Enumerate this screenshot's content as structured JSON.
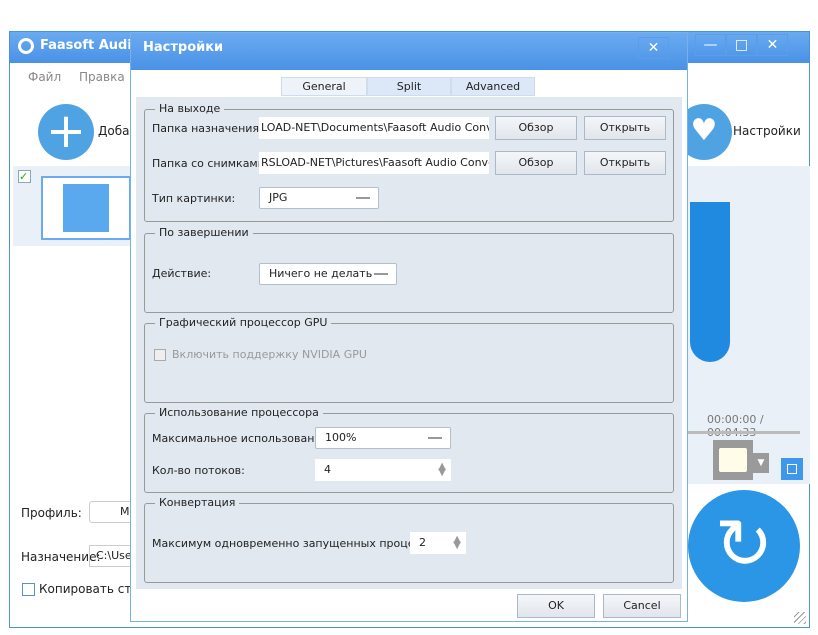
{
  "main": {
    "title": "Faasoft Audio",
    "menu": [
      "Файл",
      "Правка"
    ],
    "add_label": "Добав",
    "settings_label": "Настройки",
    "profile_label": "Профиль:",
    "profile_value": "MP",
    "dest_label": "Назначение:",
    "dest_value": "C:\\Use",
    "copy_label": "Копировать струк",
    "time": "00:00:00 / 00:04:33"
  },
  "dialog": {
    "title": "Настройки",
    "tabs": [
      "General",
      "Split",
      "Advanced"
    ],
    "output": {
      "title": "На выходе",
      "dest_label": "Папка назначения:",
      "dest_value": "LOAD-NET\\Documents\\Faasoft Audio Converter",
      "snap_label": "Папка со снимками:",
      "snap_value": "RSLOAD-NET\\Pictures\\Faasoft Audio Converter",
      "browse": "Обзор",
      "open": "Открыть",
      "type_label": "Тип картинки:",
      "type_value": "JPG"
    },
    "finish": {
      "title": "По завершении",
      "action_label": "Действие:",
      "action_value": "Ничего не делать"
    },
    "gpu": {
      "title": "Графический процессор GPU",
      "checkbox": "Включить поддержку NVIDIA GPU"
    },
    "cpu": {
      "title": "Использование процессора",
      "max_label": "Максимальное использование:",
      "max_value": "100%",
      "threads_label": "Кол-во потоков:",
      "threads_value": "4"
    },
    "conv": {
      "title": "Конвертация",
      "max_label": "Максимум одновременно запущенных процессов:",
      "max_value": "2"
    },
    "ok": "OK",
    "cancel": "Cancel"
  }
}
